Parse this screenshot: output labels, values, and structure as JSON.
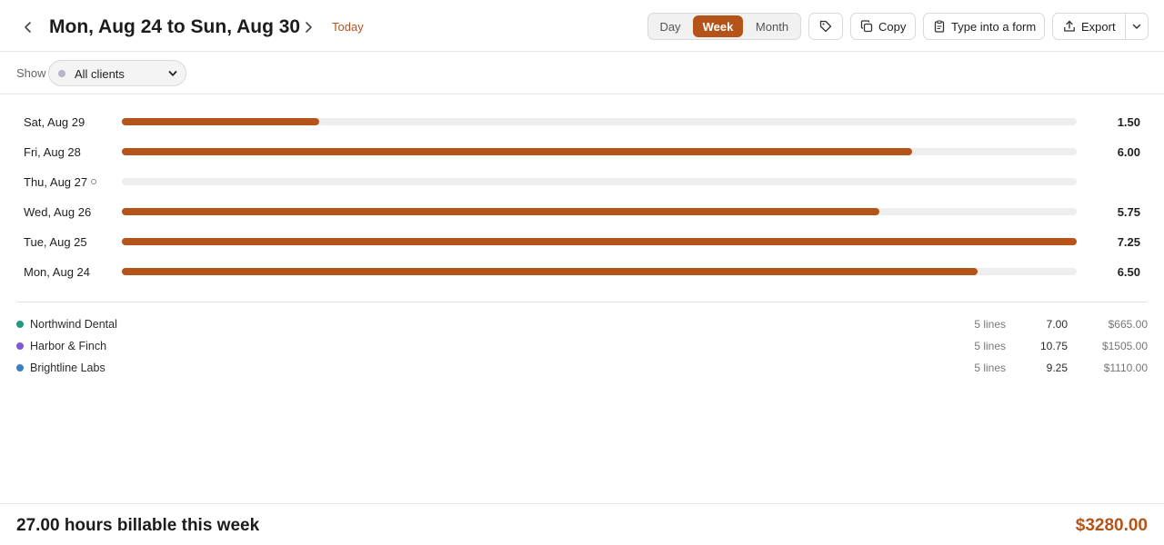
{
  "header": {
    "title": "Mon, Aug 24 to Sun, Aug 30",
    "today_label": "Today",
    "views": {
      "day": "Day",
      "week": "Week",
      "month": "Month",
      "active": "week"
    },
    "copy_label": "Copy",
    "form_label": "Type into a form",
    "export_label": "Export"
  },
  "filter": {
    "show_label": "Show",
    "selected": "All clients"
  },
  "chart_data": {
    "type": "bar",
    "orientation": "horizontal",
    "categories": [
      "Sat, Aug 29",
      "Fri, Aug 28",
      "Thu, Aug 27",
      "Wed, Aug 26",
      "Tue, Aug 25",
      "Mon, Aug 24"
    ],
    "values": [
      1.5,
      6.0,
      0,
      5.75,
      7.25,
      6.5
    ],
    "value_labels": [
      "1.50",
      "6.00",
      "",
      "5.75",
      "7.25",
      "6.50"
    ],
    "xlim": [
      0,
      7.25
    ],
    "grid": false
  },
  "days": [
    {
      "label": "Sat, Aug 29",
      "value": "1.50",
      "empty": false
    },
    {
      "label": "Fri, Aug 28",
      "value": "6.00",
      "empty": false
    },
    {
      "label": "Thu, Aug 27",
      "value": "",
      "empty": true
    },
    {
      "label": "Wed, Aug 26",
      "value": "5.75",
      "empty": false
    },
    {
      "label": "Tue, Aug 25",
      "value": "7.25",
      "empty": false
    },
    {
      "label": "Mon, Aug 24",
      "value": "6.50",
      "empty": false
    }
  ],
  "clients": [
    {
      "name": "Northwind Dental",
      "lines": "5 lines",
      "hours": "7.00",
      "amount": "$665.00",
      "color": "#1f9a7e"
    },
    {
      "name": "Harbor & Finch",
      "lines": "5 lines",
      "hours": "10.75",
      "amount": "$1505.00",
      "color": "#7b5cd6"
    },
    {
      "name": "Brightline Labs",
      "lines": "5 lines",
      "hours": "9.25",
      "amount": "$1110.00",
      "color": "#3a7fc8"
    }
  ],
  "footer": {
    "summary": "27.00 hours billable this week",
    "total": "$3280.00"
  },
  "colors": {
    "accent": "#b5541a",
    "track": "#eeeeee"
  }
}
